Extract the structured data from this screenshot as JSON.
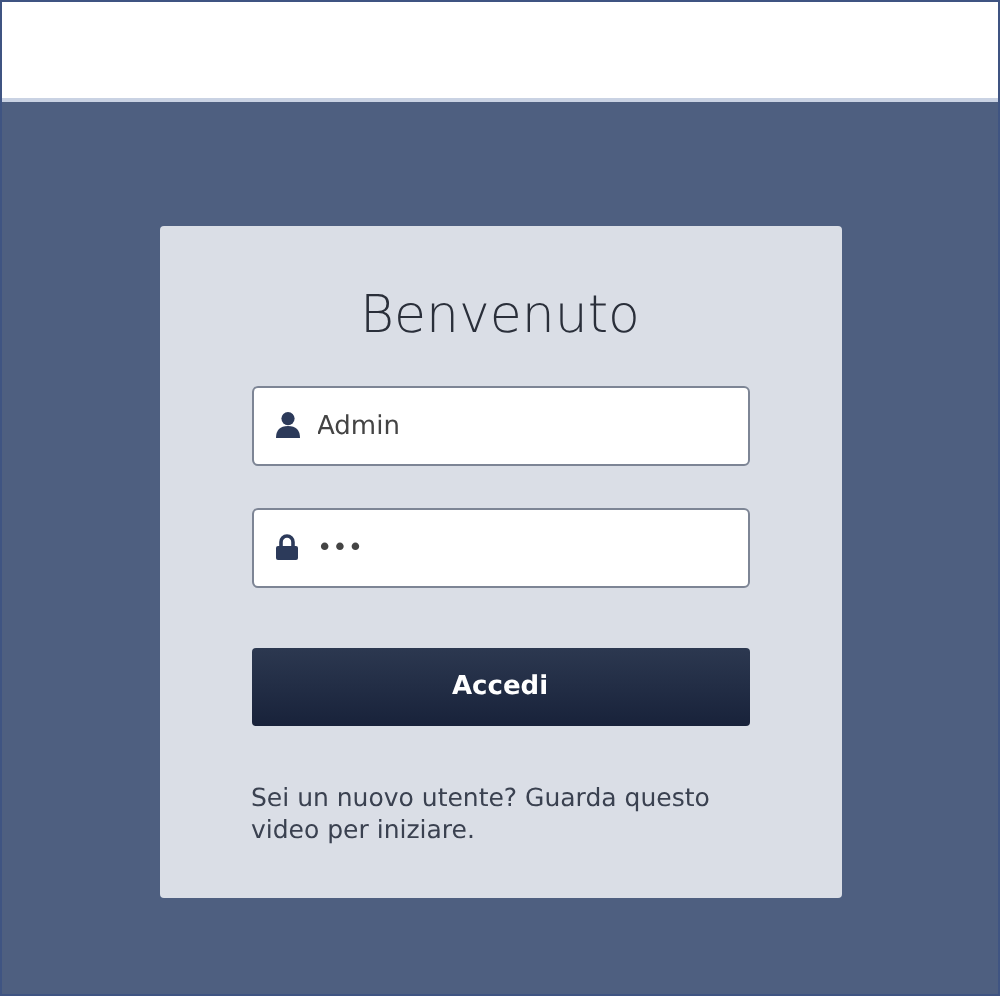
{
  "login": {
    "title": "Benvenuto",
    "fields": [
      {
        "kind": "user",
        "value": "Admin"
      },
      {
        "kind": "password",
        "value": "•••"
      }
    ],
    "button": "Accedi",
    "note": "Sei un nuovo utente? Guarda questo video per iniziare."
  }
}
